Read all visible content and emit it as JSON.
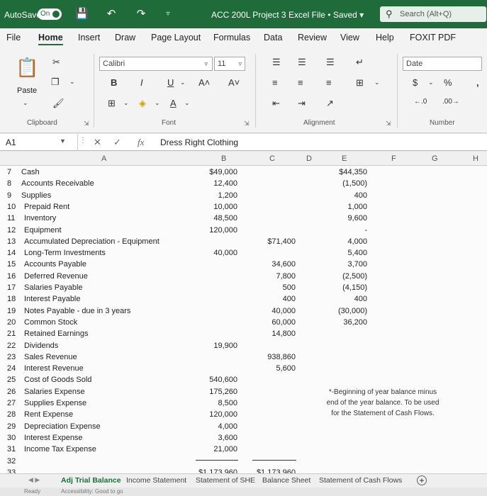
{
  "titlebar": {
    "autosave_label": "AutoSave",
    "autosave_state": "On",
    "doc_title": "ACC 200L Project 3 Excel File • Saved ▾",
    "search_placeholder": "Search (Alt+Q)"
  },
  "tabs": [
    "File",
    "Home",
    "Insert",
    "Draw",
    "Page Layout",
    "Formulas",
    "Data",
    "Review",
    "View",
    "Help",
    "FOXIT PDF"
  ],
  "active_tab": "Home",
  "ribbon": {
    "paste_label": "Paste",
    "clipboard_label": "Clipboard",
    "font_name": "Calibri",
    "font_size": "11",
    "bold": "B",
    "italic": "I",
    "underline": "U",
    "grow_font": "A˄",
    "shrink_font": "A˅",
    "font_color": "A",
    "font_label": "Font",
    "alignment_label": "Alignment",
    "number_format": "Date",
    "currency": "$",
    "percent": "%",
    "comma": ",",
    "number_label": "Number"
  },
  "formulabar": {
    "namebox": "A1",
    "fx": "fx",
    "content": "Dress Right Clothing"
  },
  "columns": [
    "A",
    "B",
    "C",
    "D",
    "E",
    "F",
    "G",
    "H"
  ],
  "rows": [
    {
      "n": "7",
      "a": "Cash",
      "b": "$49,000",
      "c": "",
      "e": "$44,350"
    },
    {
      "n": "8",
      "a": "Accounts Receivable",
      "b": "12,400",
      "c": "",
      "e": "(1,500)"
    },
    {
      "n": "9",
      "a": "Supplies",
      "b": "1,200",
      "c": "",
      "e": "400"
    },
    {
      "n": "10",
      "a": "Prepaid Rent",
      "b": "10,000",
      "c": "",
      "e": "1,000"
    },
    {
      "n": "11",
      "a": "Inventory",
      "b": "48,500",
      "c": "",
      "e": "9,600"
    },
    {
      "n": "12",
      "a": "Equipment",
      "b": "120,000",
      "c": "",
      "e": "-"
    },
    {
      "n": "13",
      "a": "Accumulated Depreciation - Equipment",
      "b": "",
      "c": "$71,400",
      "e": "4,000"
    },
    {
      "n": "14",
      "a": "Long-Term Investments",
      "b": "40,000",
      "c": "",
      "e": "5,400"
    },
    {
      "n": "15",
      "a": "Accounts Payable",
      "b": "",
      "c": "34,600",
      "e": "3,700"
    },
    {
      "n": "16",
      "a": "Deferred Revenue",
      "b": "",
      "c": "7,800",
      "e": "(2,500)"
    },
    {
      "n": "17",
      "a": "Salaries Payable",
      "b": "",
      "c": "500",
      "e": "(4,150)"
    },
    {
      "n": "18",
      "a": "Interest Payable",
      "b": "",
      "c": "400",
      "e": "400"
    },
    {
      "n": "19",
      "a": "Notes Payable - due in 3 years",
      "b": "",
      "c": "40,000",
      "e": "(30,000)"
    },
    {
      "n": "20",
      "a": "Common Stock",
      "b": "",
      "c": "60,000",
      "e": "36,200"
    },
    {
      "n": "21",
      "a": "Retained Earnings",
      "b": "",
      "c": "14,800",
      "e": ""
    },
    {
      "n": "22",
      "a": "Dividends",
      "b": "19,900",
      "c": "",
      "e": ""
    },
    {
      "n": "23",
      "a": "Sales Revenue",
      "b": "",
      "c": "938,860",
      "e": ""
    },
    {
      "n": "24",
      "a": "Interest Revenue",
      "b": "",
      "c": "5,600",
      "e": ""
    },
    {
      "n": "25",
      "a": "Cost of Goods Sold",
      "b": "540,600",
      "c": "",
      "e": ""
    },
    {
      "n": "26",
      "a": "Salaries Expense",
      "b": "175,260",
      "c": "",
      "e": ""
    },
    {
      "n": "27",
      "a": "Supplies Expense",
      "b": "8,500",
      "c": "",
      "e": ""
    },
    {
      "n": "28",
      "a": "Rent Expense",
      "b": "120,000",
      "c": "",
      "e": ""
    },
    {
      "n": "29",
      "a": "Depreciation Expense",
      "b": "4,000",
      "c": "",
      "e": ""
    },
    {
      "n": "30",
      "a": "Interest Expense",
      "b": "3,600",
      "c": "",
      "e": ""
    },
    {
      "n": "31",
      "a": "Income Tax Expense",
      "b": "21,000",
      "c": "",
      "e": ""
    },
    {
      "n": "32",
      "a": "",
      "b": "",
      "c": "",
      "e": ""
    },
    {
      "n": "33",
      "a": "",
      "b": "$1,173,960",
      "c": "$1,173,960",
      "e": ""
    }
  ],
  "note_lines": [
    "*-Beginning of year balance minus",
    "end of the year balance. To be used",
    "for the Statement of Cash Flows."
  ],
  "sheet_tabs": [
    "Adj Trial Balance",
    "Income Statement",
    "Statement of SHE",
    "Balance Sheet",
    "Statement of Cash Flows"
  ],
  "active_sheet": "Adj Trial Balance",
  "status": {
    "ready": "Ready",
    "accessibility": "Accessibility: Good to go"
  }
}
